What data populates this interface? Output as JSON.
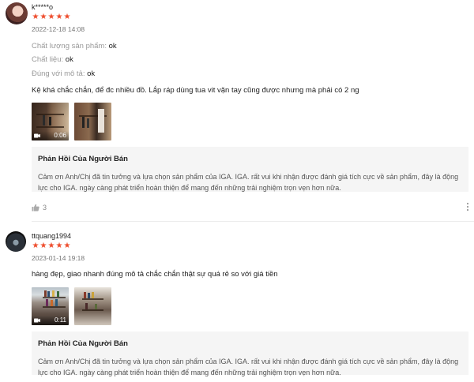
{
  "colors": {
    "star": "#ee4d2d",
    "muted": "#999999",
    "reply_bg": "#f5f5f5"
  },
  "reviews": [
    {
      "username": "k*****o",
      "rating": 5,
      "stars": [
        "★",
        "★",
        "★",
        "★",
        "★"
      ],
      "timestamp": "2022-12-18 14:08",
      "attributes": [
        {
          "label": "Chất lượng sản phẩm:",
          "value": "ok"
        },
        {
          "label": "Chất liệu:",
          "value": "ok"
        },
        {
          "label": "Đúng với mô tả:",
          "value": "ok"
        }
      ],
      "comment": "Kệ khá chắc chắn, để đc nhiều đồ. Lắp ráp dùng tua vit vặn tay cũng được nhưng mà phải có 2 ng",
      "video_duration": "0:06",
      "reply_title": "Phản Hồi Của Người Bán",
      "reply_text": "Cảm ơn Anh/Chị đã tin tưởng và lựa chọn sản phẩm của IGA. IGA. rất vui khi nhận được đánh giá tích cực về sản phẩm, đây là động lực cho IGA. ngày càng phát triển hoàn thiện để mang đến những trải nghiệm trọn vẹn hơn nữa.",
      "likes": "3",
      "like_icon": "thumbs-up-icon",
      "more_icon": "more-vertical-icon"
    },
    {
      "username": "ttquang1994",
      "rating": 5,
      "stars": [
        "★",
        "★",
        "★",
        "★",
        "★"
      ],
      "timestamp": "2023-01-14 19:18",
      "comment": "hàng đẹp, giao nhanh đúng mô tả chắc chắn thật sự quá rẻ so với giá tiền",
      "video_duration": "0:11",
      "reply_title": "Phản Hồi Của Người Bán",
      "reply_text": "Cảm ơn Anh/Chị đã tin tưởng và lựa chọn sản phẩm của IGA. IGA. rất vui khi nhận được đánh giá tích cực về sản phẩm, đây là động lực cho IGA. ngày càng phát triển hoàn thiện để mang đến những trải nghiệm trọn vẹn hơn nữa."
    }
  ]
}
